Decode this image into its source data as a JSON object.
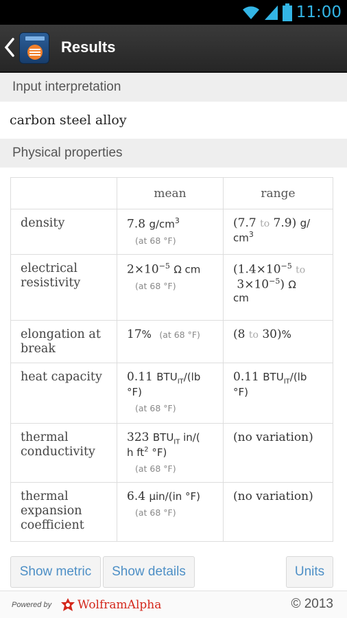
{
  "status_bar": {
    "time": "11:00",
    "icons": [
      "wifi-icon",
      "signal-icon",
      "battery-icon"
    ]
  },
  "action_bar": {
    "title": "Results",
    "app_icon_text": "Wolfram"
  },
  "sections": {
    "input_header": "Input interpretation",
    "input_value": "carbon steel alloy",
    "physical_header": "Physical properties"
  },
  "table": {
    "columns": [
      "",
      "mean",
      "range"
    ],
    "rows": [
      {
        "label": "density",
        "mean_value": "7.8",
        "mean_unit": "g/cm",
        "mean_sup": "3",
        "mean_note": "(at 68 °F)",
        "range_open": "(7.7",
        "range_to": "to",
        "range_close": "7.9)",
        "range_unit": "g/",
        "range_unit2": "cm",
        "range_sup": "3"
      },
      {
        "label": "electrical resistivity",
        "mean_value": "2×10",
        "mean_sup": "−5",
        "mean_unit": "Ω cm",
        "mean_note": "(at 68 °F)",
        "range_a": "(1.4×10",
        "range_a_sup": "−5",
        "range_to": "to",
        "range_b": "3×10",
        "range_b_sup": "−5",
        "range_close": ")",
        "range_unit": "Ω",
        "range_unit2": "cm"
      },
      {
        "label": "elongation at break",
        "mean_value": "17",
        "mean_unit": "%",
        "mean_note": "(at 68 °F)",
        "range_open": "(8",
        "range_to": "to",
        "range_close": "30)",
        "range_unit": "%"
      },
      {
        "label": "heat capacity",
        "mean_value": "0.11",
        "mean_unit": "BTU",
        "mean_unit_sub": "IT",
        "mean_unit_rest": "/(lb",
        "mean_unit_line2": "°F)",
        "mean_note": "(at 68 °F)",
        "range_value": "0.11",
        "range_unit": "BTU",
        "range_unit_sub": "IT",
        "range_unit_rest": "/(lb",
        "range_unit_line2": "°F)"
      },
      {
        "label": "thermal conductivity",
        "mean_value": "323",
        "mean_unit": "BTU",
        "mean_unit_sub": "IT",
        "mean_unit_rest": " in/(",
        "mean_unit_line2a": "h ft",
        "mean_unit_line2_sup": "2",
        "mean_unit_line2b": " °F)",
        "mean_note": "(at 68 °F)",
        "range_text": "(no variation)"
      },
      {
        "label": "thermal expansion coefficient",
        "mean_value": "6.4",
        "mean_unit": "µin/(in °F)",
        "mean_note": "(at 68 °F)",
        "range_text": "(no variation)"
      }
    ]
  },
  "buttons": {
    "show_metric": "Show metric",
    "show_details": "Show details",
    "units": "Units"
  },
  "footer": {
    "powered_by": "Powered by",
    "brand": "WolframAlpha",
    "copyright": "© 2013"
  },
  "colors": {
    "accent": "#33b5e5",
    "link": "#4d8fc6",
    "brand_red": "#d4271b"
  }
}
